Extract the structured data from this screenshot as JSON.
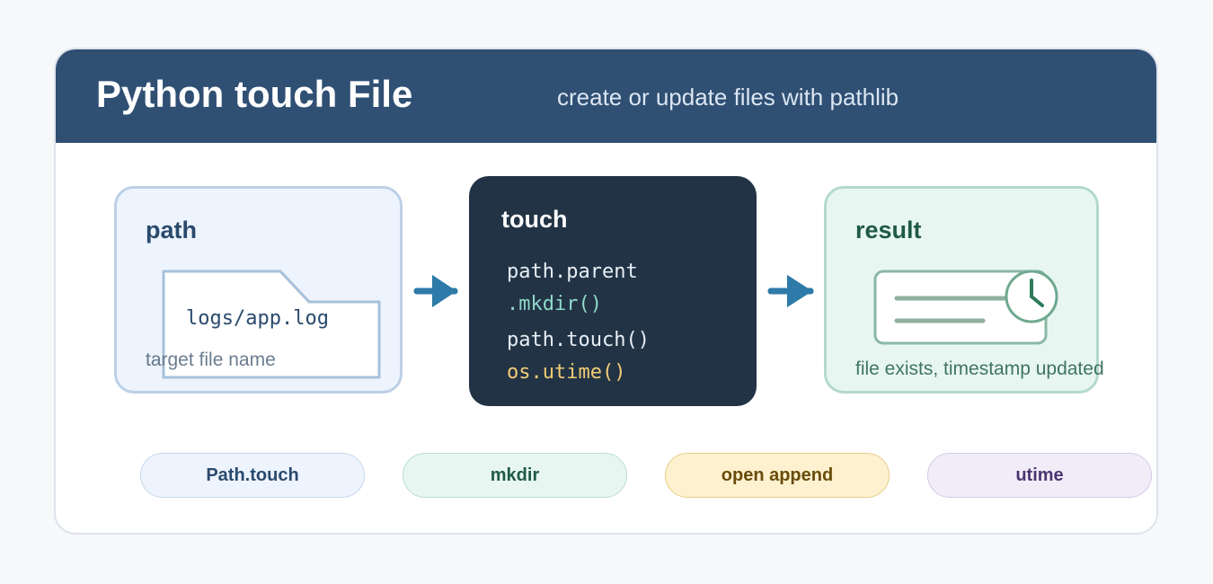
{
  "header": {
    "title": "Python touch File",
    "subtitle": "create or update files with pathlib"
  },
  "path_panel": {
    "label": "path",
    "filename": "logs/app.log",
    "caption": "target file name",
    "icon": "folder-icon"
  },
  "touch_panel": {
    "label": "touch",
    "code_lines": [
      "path.parent",
      ".mkdir()",
      "path.touch()",
      "os.utime()"
    ]
  },
  "result_panel": {
    "label": "result",
    "caption": "file exists, timestamp updated",
    "icon": "file-clock-icon"
  },
  "pills": [
    {
      "label": "Path.touch"
    },
    {
      "label": "mkdir"
    },
    {
      "label": "open append"
    },
    {
      "label": "utime"
    }
  ],
  "colors": {
    "header_bg": "#2f4f73",
    "path_accent": "#2a4a6c",
    "touch_bg": "#223345",
    "result_accent": "#1f5a45",
    "arrow": "#2e7aa8",
    "mkdir_code": "#8fd8c9",
    "utime_code": "#f2cc76"
  }
}
